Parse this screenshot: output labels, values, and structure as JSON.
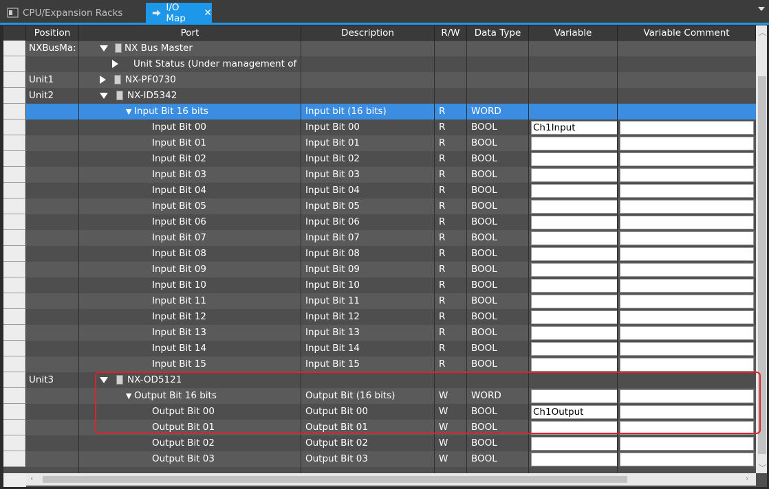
{
  "tabs": [
    {
      "label": "CPU/Expansion Racks",
      "active": false
    },
    {
      "label": "I/O Map",
      "active": true
    }
  ],
  "columns": [
    "Position",
    "Port",
    "Description",
    "R/W",
    "Data Type",
    "Variable",
    "Variable Comment"
  ],
  "rows": [
    {
      "position": "NXBusMa:",
      "port": "NX Bus Master",
      "expander": "down",
      "icon": "cpu",
      "indent": 0,
      "desc": "",
      "rw": "",
      "type": "",
      "variable": null
    },
    {
      "position": "",
      "port": "Unit Status (Under management of",
      "expander": "right",
      "icon": "",
      "indent": 1,
      "desc": "",
      "rw": "",
      "type": "",
      "variable": null
    },
    {
      "position": "Unit1",
      "port": "NX-PF0730",
      "expander": "right",
      "icon": "module",
      "indent": 0,
      "desc": "",
      "rw": "",
      "type": "",
      "variable": null
    },
    {
      "position": "Unit2",
      "port": "NX-ID5342",
      "expander": "down",
      "icon": "module",
      "indent": 0,
      "desc": "",
      "rw": "",
      "type": "",
      "variable": null
    },
    {
      "position": "",
      "port": "Input Bit 16 bits",
      "expander": "down-small",
      "icon": "",
      "indent": 1,
      "desc": "Input bit (16 bits)",
      "rw": "R",
      "type": "WORD",
      "variable": null,
      "selected": true
    },
    {
      "position": "",
      "port": "Input Bit 00",
      "indent": 2,
      "desc": "Input Bit 00",
      "rw": "R",
      "type": "BOOL",
      "variable": "Ch1Input"
    },
    {
      "position": "",
      "port": "Input Bit 01",
      "indent": 2,
      "desc": "Input Bit 01",
      "rw": "R",
      "type": "BOOL",
      "variable": ""
    },
    {
      "position": "",
      "port": "Input Bit 02",
      "indent": 2,
      "desc": "Input Bit 02",
      "rw": "R",
      "type": "BOOL",
      "variable": ""
    },
    {
      "position": "",
      "port": "Input Bit 03",
      "indent": 2,
      "desc": "Input Bit 03",
      "rw": "R",
      "type": "BOOL",
      "variable": ""
    },
    {
      "position": "",
      "port": "Input Bit 04",
      "indent": 2,
      "desc": "Input Bit 04",
      "rw": "R",
      "type": "BOOL",
      "variable": ""
    },
    {
      "position": "",
      "port": "Input Bit 05",
      "indent": 2,
      "desc": "Input Bit 05",
      "rw": "R",
      "type": "BOOL",
      "variable": ""
    },
    {
      "position": "",
      "port": "Input Bit 06",
      "indent": 2,
      "desc": "Input Bit 06",
      "rw": "R",
      "type": "BOOL",
      "variable": ""
    },
    {
      "position": "",
      "port": "Input Bit 07",
      "indent": 2,
      "desc": "Input Bit 07",
      "rw": "R",
      "type": "BOOL",
      "variable": ""
    },
    {
      "position": "",
      "port": "Input Bit 08",
      "indent": 2,
      "desc": "Input Bit 08",
      "rw": "R",
      "type": "BOOL",
      "variable": ""
    },
    {
      "position": "",
      "port": "Input Bit 09",
      "indent": 2,
      "desc": "Input Bit 09",
      "rw": "R",
      "type": "BOOL",
      "variable": ""
    },
    {
      "position": "",
      "port": "Input Bit 10",
      "indent": 2,
      "desc": "Input Bit 10",
      "rw": "R",
      "type": "BOOL",
      "variable": ""
    },
    {
      "position": "",
      "port": "Input Bit 11",
      "indent": 2,
      "desc": "Input Bit 11",
      "rw": "R",
      "type": "BOOL",
      "variable": ""
    },
    {
      "position": "",
      "port": "Input Bit 12",
      "indent": 2,
      "desc": "Input Bit 12",
      "rw": "R",
      "type": "BOOL",
      "variable": ""
    },
    {
      "position": "",
      "port": "Input Bit 13",
      "indent": 2,
      "desc": "Input Bit 13",
      "rw": "R",
      "type": "BOOL",
      "variable": ""
    },
    {
      "position": "",
      "port": "Input Bit 14",
      "indent": 2,
      "desc": "Input Bit 14",
      "rw": "R",
      "type": "BOOL",
      "variable": ""
    },
    {
      "position": "",
      "port": "Input Bit 15",
      "indent": 2,
      "desc": "Input Bit 15",
      "rw": "R",
      "type": "BOOL",
      "variable": ""
    },
    {
      "position": "Unit3",
      "port": "NX-OD5121",
      "expander": "down",
      "icon": "module",
      "indent": 0,
      "desc": "",
      "rw": "",
      "type": "",
      "variable": null
    },
    {
      "position": "",
      "port": "Output Bit 16 bits",
      "expander": "down-small",
      "icon": "",
      "indent": 1,
      "desc": "Output Bit (16 bits)",
      "rw": "W",
      "type": "WORD",
      "variable": ""
    },
    {
      "position": "",
      "port": "Output Bit 00",
      "indent": 2,
      "desc": "Output Bit 00",
      "rw": "W",
      "type": "BOOL",
      "variable": "Ch1Output"
    },
    {
      "position": "",
      "port": "Output Bit 01",
      "indent": 2,
      "desc": "Output Bit 01",
      "rw": "W",
      "type": "BOOL",
      "variable": ""
    },
    {
      "position": "",
      "port": "Output Bit 02",
      "indent": 2,
      "desc": "Output Bit 02",
      "rw": "W",
      "type": "BOOL",
      "variable": ""
    },
    {
      "position": "",
      "port": "Output Bit 03",
      "indent": 2,
      "desc": "Output Bit 03",
      "rw": "W",
      "type": "BOOL",
      "variable": ""
    }
  ],
  "colors": {
    "accent": "#1c97ea",
    "selection": "#3a8de0",
    "highlight_box": "#e2212b"
  }
}
